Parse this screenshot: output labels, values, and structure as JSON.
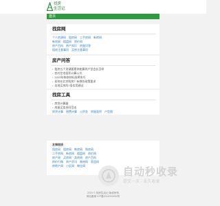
{
  "header": {
    "logo_line1": "找房",
    "logo_line2": "生活记"
  },
  "nav": {
    "home": "首页"
  },
  "sections": {
    "find": {
      "title": "找房网",
      "rows": [
        [
          "个人房源网",
          "租房网",
          "二手房网",
          "新房网"
        ],
        [
          "新房网",
          "楼盘网",
          "房价网"
        ],
        [
          "房产百科",
          "房产知识",
          "房屋问答"
        ],
        [
          "租房注意事项",
          "买房注意事项"
        ]
      ]
    },
    "qa": {
      "title": "房产问答",
      "items": [
        "租房五个关键要素你能算到户型会长怎样",
        "农村住宅面积计算公式",
        "2023年装修材料选择技巧",
        "如何在北京购房？有哪些政策要求",
        "本地买房的7条实用建议"
      ]
    },
    "tools": {
      "title": "找房工具",
      "items": [
        "房贷计算器",
        "房屋买卖合同范本"
      ],
      "row": [
        "房贷计算",
        "税费计算",
        "公积金",
        "房屋面积",
        "户型图"
      ]
    }
  },
  "friends": {
    "title": "友情链接",
    "rows": [
      [
        "找房网",
        "租房网",
        "售房网",
        "购房网"
      ],
      [
        "二手房网",
        "新房网",
        "楼盘网",
        "房价网"
      ],
      [
        "房产网",
        "买房网",
        "卖房网",
        "房产百科"
      ],
      [
        "房价行情",
        "房产资讯",
        "装修网",
        "家居网"
      ],
      [
        "房地产网",
        "小区网",
        "物业网"
      ]
    ]
  },
  "watermark": {
    "big": "自动秒收录",
    "small": "提交一次 · 永久收录"
  },
  "footer": {
    "line1": "2024 © 找房生活记 版权所有",
    "line2": "网站备案 ICP备2024000000号"
  },
  "colors": {
    "brand": "#2f9a3f",
    "link": "#2f7fbf"
  }
}
